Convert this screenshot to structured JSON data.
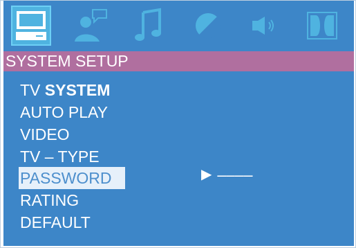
{
  "header": {
    "title": "SYSTEM SETUP"
  },
  "tabs": [
    {
      "id": "system",
      "icon": "monitor-icon",
      "selected": true
    },
    {
      "id": "language",
      "icon": "speaking-person-icon",
      "selected": false
    },
    {
      "id": "audio",
      "icon": "music-note-icon",
      "selected": false
    },
    {
      "id": "video",
      "icon": "contrast-icon",
      "selected": false
    },
    {
      "id": "speaker",
      "icon": "speaker-icon",
      "selected": false
    },
    {
      "id": "digital",
      "icon": "dolby-digital-icon",
      "selected": false
    }
  ],
  "menu": {
    "items": [
      {
        "prefix": "TV ",
        "bold": "SYSTEM"
      },
      {
        "label": "AUTO PLAY"
      },
      {
        "label": "VIDEO"
      },
      {
        "label": "TV – TYPE"
      },
      {
        "label": "PASSWORD",
        "selected": true
      },
      {
        "label": "RATING"
      },
      {
        "label": "DEFAULT"
      }
    ]
  },
  "password": {
    "arrow": "▶",
    "value": "––––"
  },
  "colors": {
    "background": "#3d86c8",
    "header": "#b06f9f",
    "selected_bg": "#e6f0fa",
    "selected_text": "#4d8fcd",
    "icon_fill": "#4fb3e0"
  }
}
